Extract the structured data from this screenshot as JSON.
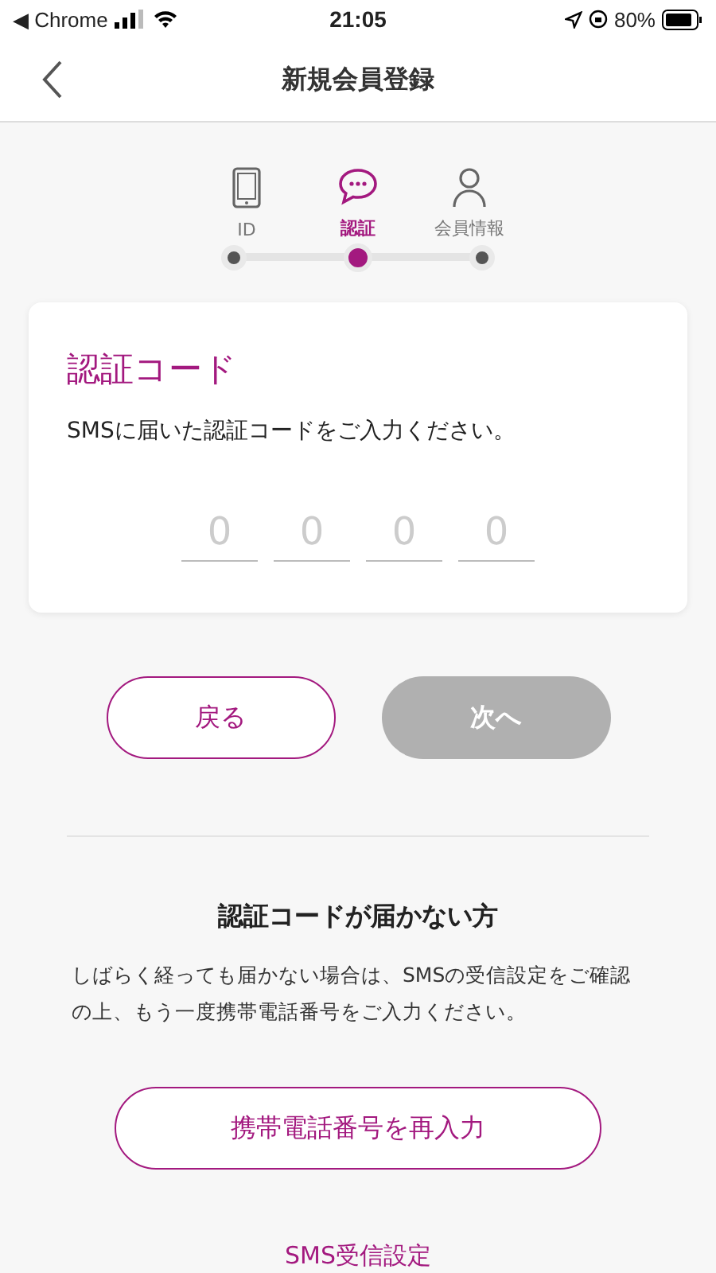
{
  "status_bar": {
    "back_app": "◀ Chrome",
    "time": "21:05",
    "battery": "80%"
  },
  "header": {
    "title": "新規会員登録"
  },
  "steps": [
    {
      "kind": "phone",
      "label": "ID",
      "selected": false
    },
    {
      "kind": "chat",
      "label": "認証",
      "selected": true
    },
    {
      "kind": "person",
      "label": "会員情報",
      "selected": false
    }
  ],
  "card": {
    "title": "認証コード",
    "description": "SMSに届いた認証コードをご入力ください。",
    "code_inputs": [
      {
        "placeholder": "0"
      },
      {
        "placeholder": "0"
      },
      {
        "placeholder": "0"
      },
      {
        "placeholder": "0"
      }
    ]
  },
  "buttons": [
    {
      "label": "戻る",
      "disabled": false
    },
    {
      "label": "次へ",
      "disabled": true
    }
  ],
  "help": {
    "title": "認証コードが届かない方",
    "text": "しばらく経っても届かない場合は、SMSの受信設定をご確認の上、もう一度携帯電話番号をご入力ください。",
    "button": "携帯電話番号を再入力",
    "link": "SMS受信設定"
  }
}
